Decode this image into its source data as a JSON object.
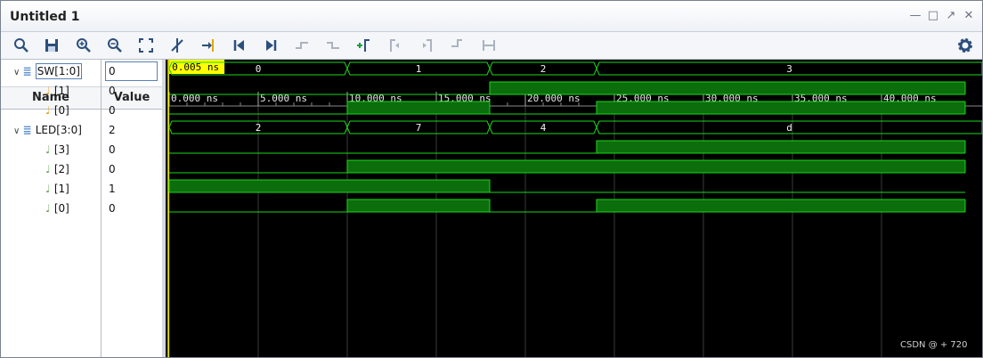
{
  "window": {
    "title": "Untitled 1"
  },
  "cursor": {
    "label": "0.005 ns"
  },
  "columns": {
    "name": "Name",
    "value": "Value"
  },
  "signals": [
    {
      "name": "SW[1:0]",
      "value": "0",
      "kind": "bus-in",
      "indent": 0,
      "expanded": true
    },
    {
      "name": "[1]",
      "value": "0",
      "kind": "bit-in",
      "indent": 1
    },
    {
      "name": "[0]",
      "value": "0",
      "kind": "bit-in",
      "indent": 1
    },
    {
      "name": "LED[3:0]",
      "value": "2",
      "kind": "bus-out",
      "indent": 0,
      "expanded": true
    },
    {
      "name": "[3]",
      "value": "0",
      "kind": "bit-out",
      "indent": 1
    },
    {
      "name": "[2]",
      "value": "0",
      "kind": "bit-out",
      "indent": 1
    },
    {
      "name": "[1]",
      "value": "1",
      "kind": "bit-out",
      "indent": 1
    },
    {
      "name": "[0]",
      "value": "0",
      "kind": "bit-out",
      "indent": 1
    }
  ],
  "timeline": {
    "ticks": [
      "0.000 ns",
      "5.000 ns",
      "10.000 ns",
      "15.000 ns",
      "20.000 ns",
      "25.000 ns",
      "30.000 ns",
      "35.000 ns",
      "40.000 ns"
    ],
    "tick_step_ns": 5,
    "visible_range_ns": [
      0,
      44.7
    ]
  },
  "waves": {
    "SW": {
      "edges_ns": [
        0,
        10,
        18,
        24
      ],
      "values": [
        "0",
        "1",
        "2",
        "3"
      ]
    },
    "SW1": {
      "transitions": [
        [
          0,
          0
        ],
        [
          18,
          1
        ]
      ]
    },
    "SW0": {
      "transitions": [
        [
          0,
          0
        ],
        [
          10,
          1
        ],
        [
          18,
          0
        ],
        [
          24,
          1
        ]
      ]
    },
    "LED": {
      "edges_ns": [
        0,
        10,
        18,
        24
      ],
      "values": [
        "2",
        "7",
        "4",
        "d"
      ]
    },
    "LED3": {
      "transitions": [
        [
          0,
          0
        ],
        [
          24,
          1
        ]
      ]
    },
    "LED2": {
      "transitions": [
        [
          0,
          0
        ],
        [
          10,
          1
        ]
      ]
    },
    "LED1": {
      "transitions": [
        [
          0,
          1
        ],
        [
          18,
          0
        ]
      ]
    },
    "LED0": {
      "transitions": [
        [
          0,
          0
        ],
        [
          10,
          1
        ],
        [
          18,
          0
        ],
        [
          24,
          1
        ]
      ]
    }
  },
  "colors": {
    "wave": "#19d919",
    "wave_fill": "#0c6d0c",
    "cursor": "#ffff00",
    "grid": "#3a3a3a"
  },
  "watermark": "CSDN @ + 720"
}
